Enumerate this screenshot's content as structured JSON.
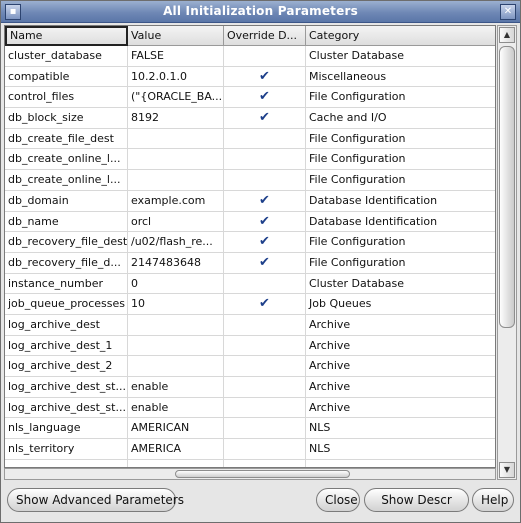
{
  "window": {
    "title": "All Initialization Parameters"
  },
  "table": {
    "columns": [
      "Name",
      "Value",
      "Override D...",
      "Category"
    ],
    "rows": [
      {
        "name": "cluster_database",
        "value": "FALSE",
        "override": "",
        "category": "Cluster Database"
      },
      {
        "name": "compatible",
        "value": "10.2.0.1.0",
        "override": "✔",
        "category": "Miscellaneous"
      },
      {
        "name": "control_files",
        "value": "(\"{ORACLE_BA...",
        "override": "✔",
        "category": "File Configuration"
      },
      {
        "name": "db_block_size",
        "value": "8192",
        "override": "✔",
        "category": "Cache and I/O"
      },
      {
        "name": "db_create_file_dest",
        "value": "",
        "override": "",
        "category": "File Configuration"
      },
      {
        "name": "db_create_online_l...",
        "value": "",
        "override": "",
        "category": "File Configuration"
      },
      {
        "name": "db_create_online_l...",
        "value": "",
        "override": "",
        "category": "File Configuration"
      },
      {
        "name": "db_domain",
        "value": "example.com",
        "override": "✔",
        "category": "Database Identification"
      },
      {
        "name": "db_name",
        "value": "orcl",
        "override": "✔",
        "category": "Database Identification"
      },
      {
        "name": "db_recovery_file_dest",
        "value": "/u02/flash_re...",
        "override": "✔",
        "category": "File Configuration"
      },
      {
        "name": "db_recovery_file_d...",
        "value": "2147483648",
        "override": "✔",
        "category": "File Configuration"
      },
      {
        "name": "instance_number",
        "value": "0",
        "override": "",
        "category": "Cluster Database"
      },
      {
        "name": "job_queue_processes",
        "value": "10",
        "override": "✔",
        "category": "Job Queues"
      },
      {
        "name": "log_archive_dest",
        "value": "",
        "override": "",
        "category": "Archive"
      },
      {
        "name": "log_archive_dest_1",
        "value": "",
        "override": "",
        "category": "Archive"
      },
      {
        "name": "log_archive_dest_2",
        "value": "",
        "override": "",
        "category": "Archive"
      },
      {
        "name": "log_archive_dest_st...",
        "value": "enable",
        "override": "",
        "category": "Archive"
      },
      {
        "name": "log_archive_dest_st...",
        "value": "enable",
        "override": "",
        "category": "Archive"
      },
      {
        "name": "nls_language",
        "value": "AMERICAN",
        "override": "",
        "category": "NLS"
      },
      {
        "name": "nls_territory",
        "value": "AMERICA",
        "override": "",
        "category": "NLS"
      },
      {
        "name": "",
        "value": "",
        "override": "",
        "category": ""
      }
    ]
  },
  "buttons": {
    "advanced": "Show Advanced Parameters",
    "close": "Close",
    "show": "Show Descr",
    "help": "Help"
  }
}
